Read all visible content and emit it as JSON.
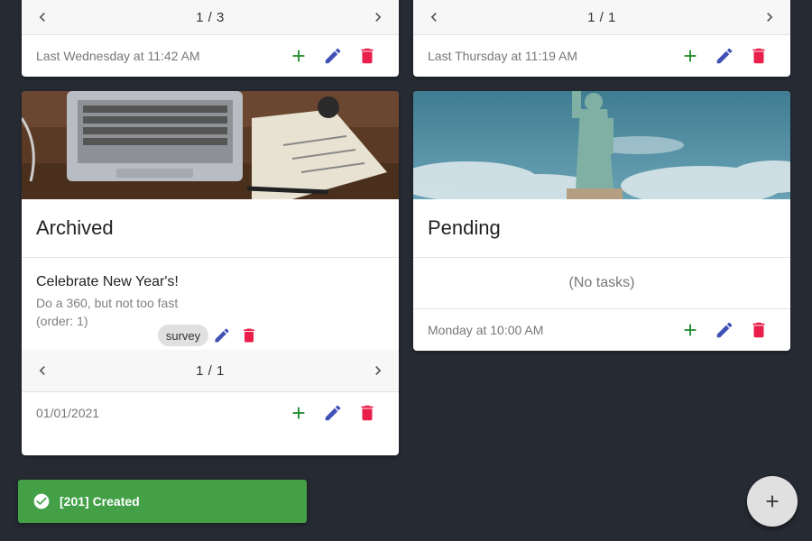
{
  "cards": {
    "top_left": {
      "page": "1 / 3",
      "timestamp": "Last Wednesday at 11:42 AM"
    },
    "top_right": {
      "page": "1 / 1",
      "timestamp": "Last Thursday at 11:19 AM"
    },
    "archived": {
      "title": "Archived",
      "task": {
        "title": "Celebrate New Year's!",
        "description": "Do a 360, but not too fast",
        "order": "(order: 1)",
        "tag": "survey"
      },
      "page": "1 / 1",
      "timestamp": "01/01/2021"
    },
    "pending": {
      "title": "Pending",
      "empty_text": "(No tasks)",
      "timestamp": "Monday at 10:00 AM"
    }
  },
  "snackbar": {
    "message": "[201] Created"
  },
  "colors": {
    "background": "#262a33",
    "add": "#1a8a2a",
    "edit": "#3f51b5",
    "delete": "#e91e4a",
    "snackbar": "#43a047"
  },
  "icons": {
    "prev": "chevron-left-icon",
    "next": "chevron-right-icon",
    "add": "plus-icon",
    "edit": "pencil-icon",
    "delete": "trash-icon",
    "success": "check-circle-icon",
    "fab": "plus-icon"
  }
}
